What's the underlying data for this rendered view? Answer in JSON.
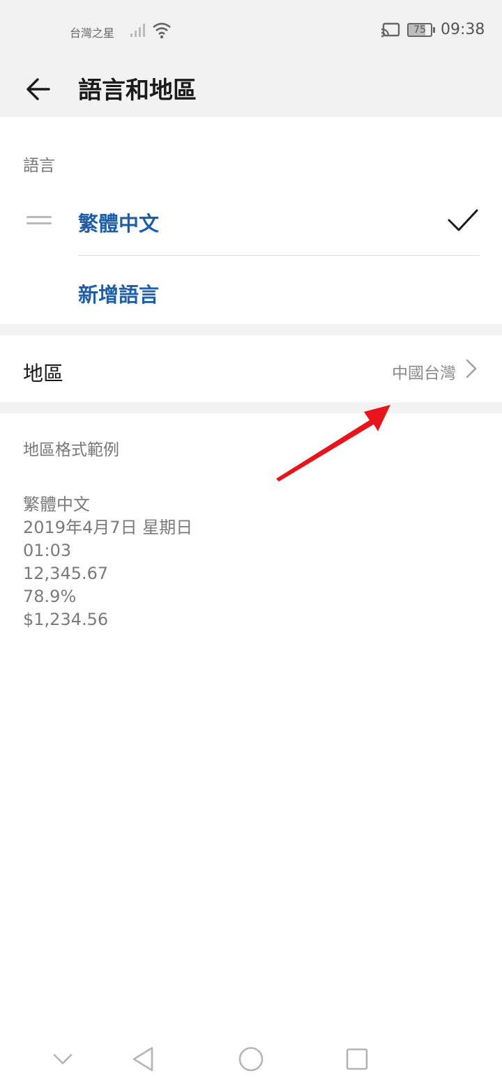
{
  "status_bar": {
    "carrier": "台灣之星",
    "battery": "75",
    "time": "09:38",
    "icons": [
      "signal-icon",
      "wifi-icon",
      "cast-icon",
      "battery-icon"
    ]
  },
  "header": {
    "title": "語言和地區",
    "back_icon": "back-arrow-icon"
  },
  "language_section": {
    "label": "語言",
    "languages": [
      {
        "name": "繁體中文",
        "selected": true
      }
    ],
    "add_label": "新增語言"
  },
  "region": {
    "label": "地區",
    "value": "中國台灣"
  },
  "format_example": {
    "label": "地區格式範例",
    "lines": [
      "繁體中文",
      "2019年4月7日 星期日",
      "01:03",
      "12,345.67",
      "78.9%",
      "$1,234.56"
    ]
  },
  "nav_bar": {
    "buttons": [
      "collapse-icon",
      "back-triangle-icon",
      "home-circle-icon",
      "recents-square-icon"
    ]
  },
  "colors": {
    "accent": "#1f5fa8",
    "annotation": "#e8141c",
    "background_gray": "#f2f2f2"
  }
}
